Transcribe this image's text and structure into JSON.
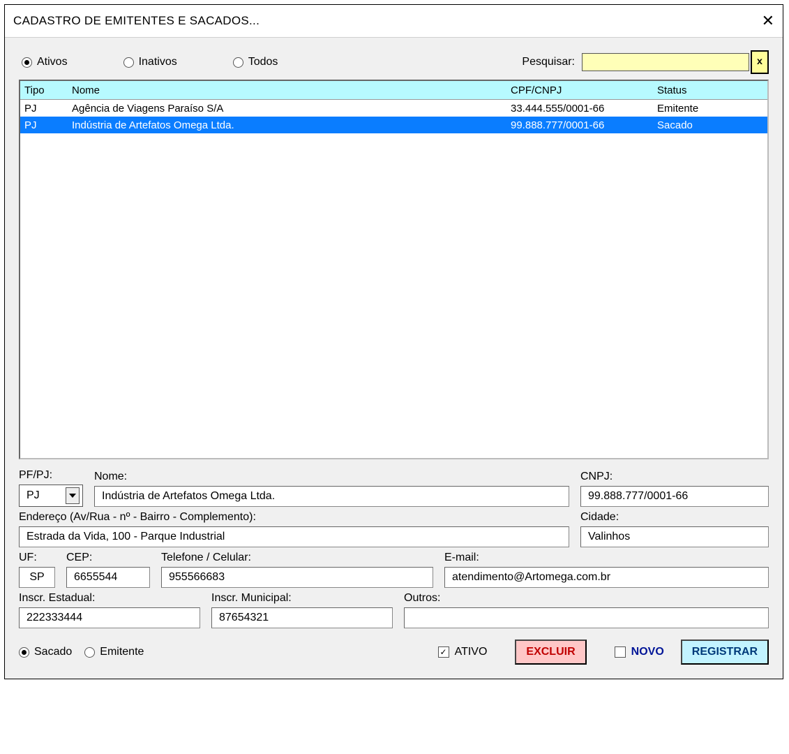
{
  "window": {
    "title": "CADASTRO DE EMITENTES E SACADOS..."
  },
  "filters": {
    "ativos": "Ativos",
    "inativos": "Inativos",
    "todos": "Todos",
    "selected": "ativos",
    "search_label": "Pesquisar:",
    "search_value": "",
    "search_btn": "x"
  },
  "grid": {
    "headers": {
      "tipo": "Tipo",
      "nome": "Nome",
      "doc": "CPF/CNPJ",
      "status": "Status"
    },
    "rows": [
      {
        "tipo": "PJ",
        "nome": "Agência de Viagens Paraíso S/A",
        "doc": "33.444.555/0001-66",
        "status": "Emitente",
        "selected": false
      },
      {
        "tipo": "PJ",
        "nome": "Indústria de Artefatos Omega Ltda.",
        "doc": "99.888.777/0001-66",
        "status": "Sacado",
        "selected": true
      }
    ]
  },
  "form": {
    "labels": {
      "pfpj": "PF/PJ:",
      "nome": "Nome:",
      "cnpj": "CNPJ:",
      "endereco": "Endereço (Av/Rua - nº - Bairro - Complemento):",
      "cidade": "Cidade:",
      "uf": "UF:",
      "cep": "CEP:",
      "tel": "Telefone / Celular:",
      "email": "E-mail:",
      "inscr_est": "Inscr. Estadual:",
      "inscr_mun": "Inscr. Municipal:",
      "outros": "Outros:"
    },
    "values": {
      "pfpj": "PJ",
      "nome": "Indústria de Artefatos Omega Ltda.",
      "cnpj": "99.888.777/0001-66",
      "endereco": "Estrada da Vida, 100 - Parque Industrial",
      "cidade": "Valinhos",
      "uf": "SP",
      "cep": "6655544",
      "tel": "955566683",
      "email": "atendimento@Artomega.com.br",
      "inscr_est": "222333444",
      "inscr_mun": "87654321",
      "outros": ""
    },
    "role": {
      "sacado": "Sacado",
      "emitente": "Emitente",
      "selected": "sacado"
    },
    "ativo_label": "ATIVO",
    "ativo_checked": true,
    "novo_label": "NOVO",
    "novo_checked": false
  },
  "buttons": {
    "excluir": "EXCLUIR",
    "registrar": "REGISTRAR"
  }
}
